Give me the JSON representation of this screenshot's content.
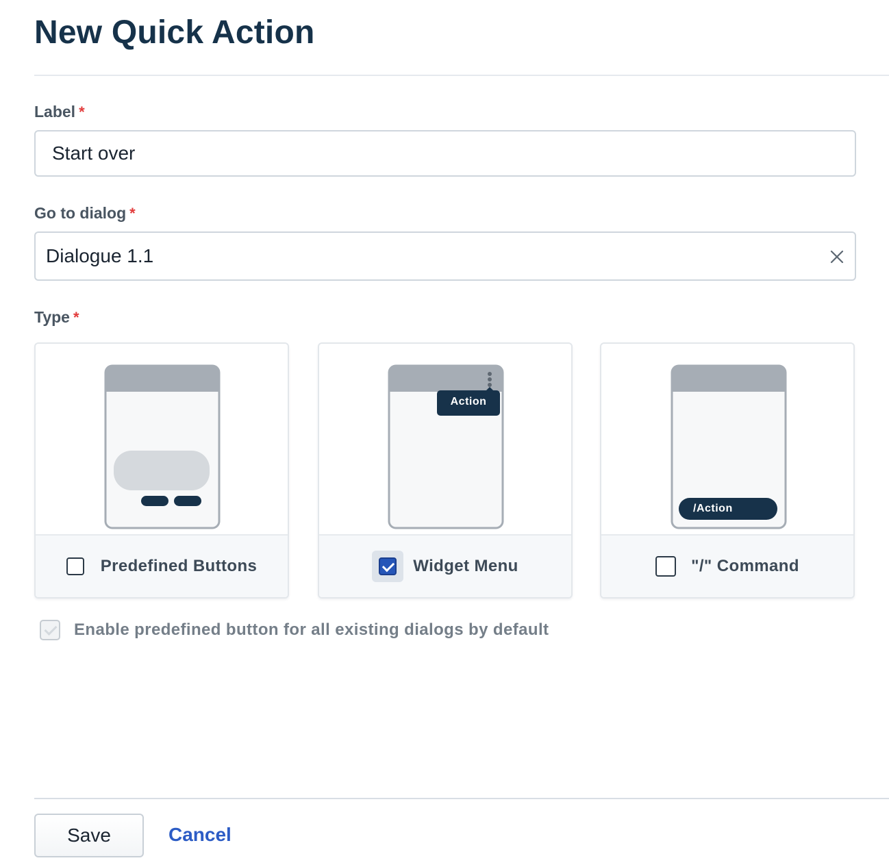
{
  "page": {
    "title": "New Quick Action"
  },
  "form": {
    "label": {
      "label": "Label",
      "required_mark": "*",
      "value": "Start over"
    },
    "dialog": {
      "label": "Go to dialog",
      "required_mark": "*",
      "value": "Dialogue 1.1",
      "clear_icon": "close-icon"
    },
    "type": {
      "label": "Type",
      "required_mark": "*",
      "options": [
        {
          "label": "Predefined Buttons",
          "checked": false
        },
        {
          "label": "Widget Menu",
          "checked": true,
          "preview_tag": "Action"
        },
        {
          "label": "\"/\" Command",
          "checked": false,
          "preview_tag": "/Action"
        }
      ]
    },
    "default_option": {
      "label": "Enable predefined button for all existing dialogs by default",
      "checked": true,
      "disabled": true
    }
  },
  "actions": {
    "save_label": "Save",
    "cancel_label": "Cancel"
  },
  "colors": {
    "accent": "#2656b8",
    "heading": "#16324a",
    "required": "#e23b3b",
    "link": "#2c5cc5"
  }
}
